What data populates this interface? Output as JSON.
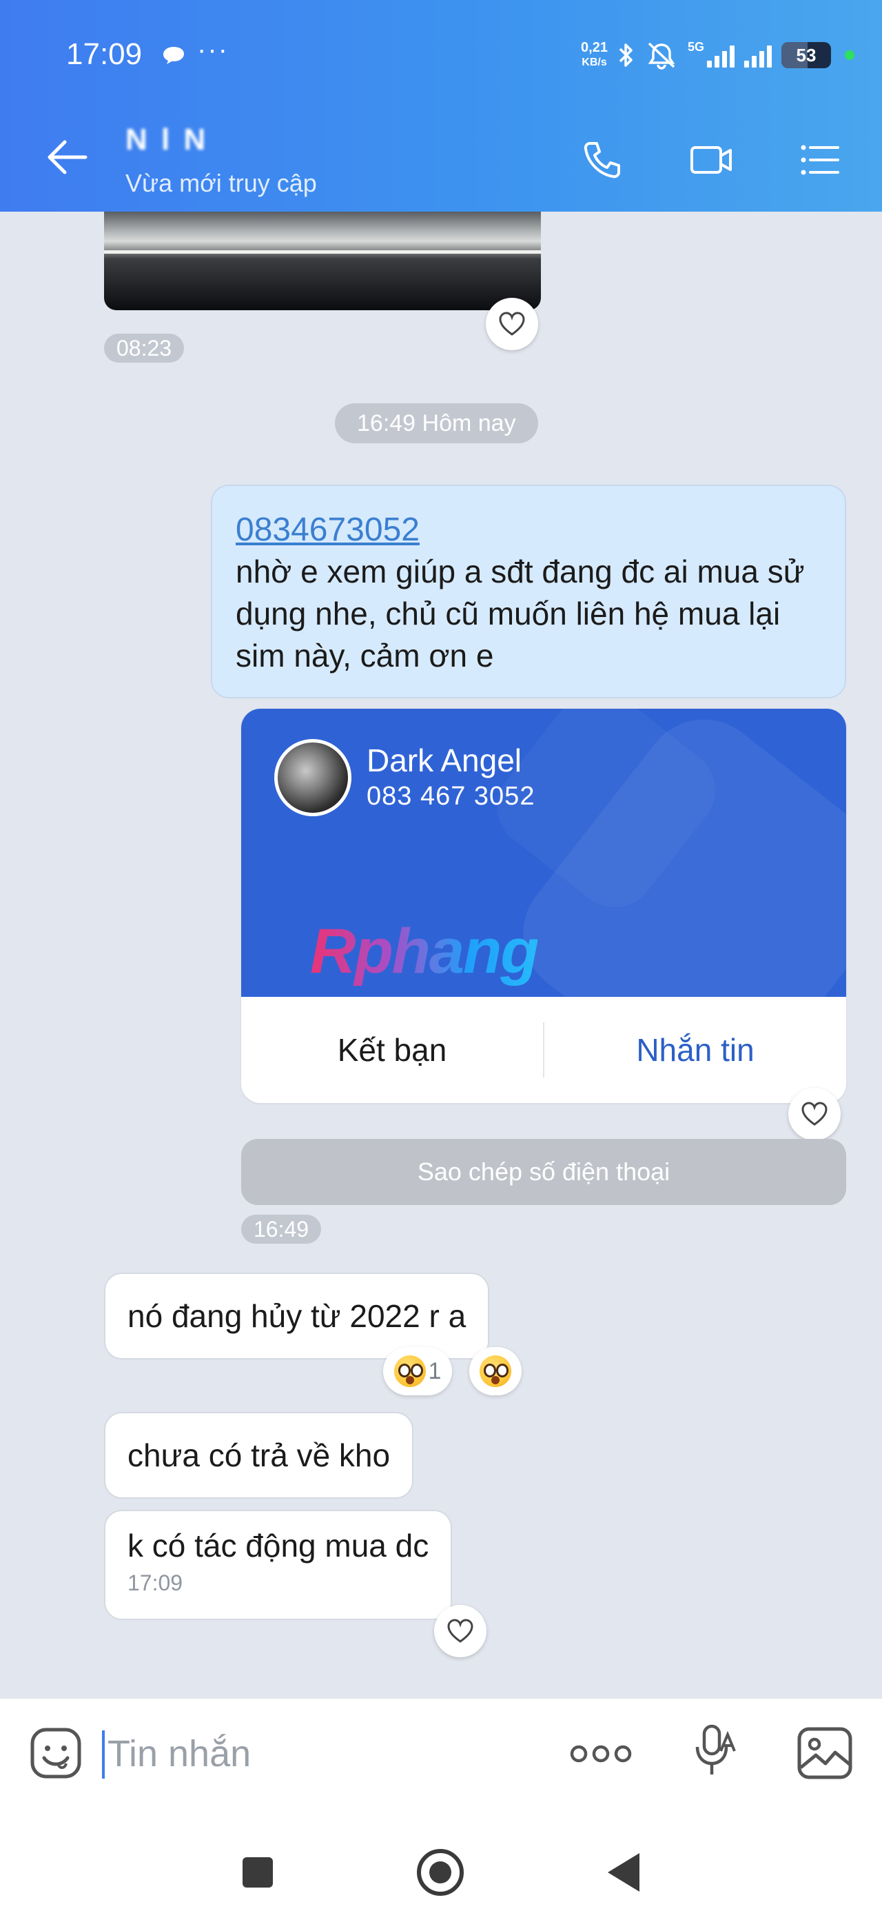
{
  "status_bar": {
    "time": "17:09",
    "more": "···",
    "speed_value": "0,21",
    "speed_unit": "KB/s",
    "network": "5G",
    "battery": "53"
  },
  "header": {
    "contact_name": "N   l N",
    "subtitle": "Vừa mới truy cập"
  },
  "chat": {
    "photo_time": "08:23",
    "date_separator": "16:49 Hôm nay",
    "sent_message": {
      "phone": "0834673052",
      "text": "nhờ e xem giúp a sđt đang đc ai mua sử dụng nhe, chủ cũ muốn liên hệ mua lại sim này, cảm ơn e"
    },
    "contact_card": {
      "name": "Dark Angel",
      "phone": "083 467 3052",
      "watermark": "Rphang",
      "add_friend_label": "Kết bạn",
      "message_label": "Nhắn tin"
    },
    "copy_phone_label": "Sao chép số điện thoại",
    "sent_time": "16:49",
    "received": [
      {
        "text": "nó đang hủy từ 2022 r a"
      },
      {
        "text": "chưa có trả về kho"
      },
      {
        "text": "k có tác động mua dc",
        "time": "17:09"
      }
    ],
    "reaction_count": "1"
  },
  "composer": {
    "placeholder": "Tin nhắn"
  },
  "icons": {
    "back": "arrow-left-icon",
    "call": "phone-icon",
    "video": "video-camera-icon",
    "menu": "list-menu-icon",
    "sticker": "sticker-icon",
    "more": "more-dots-icon",
    "mic": "voice-mic-icon",
    "image": "image-icon"
  },
  "colors": {
    "header_start": "#3f7cf0",
    "header_end": "#4aa6ee",
    "sent_bubble": "#d6eafd",
    "card_blue": "#2f63d5",
    "link_blue": "#3a7fd0"
  }
}
